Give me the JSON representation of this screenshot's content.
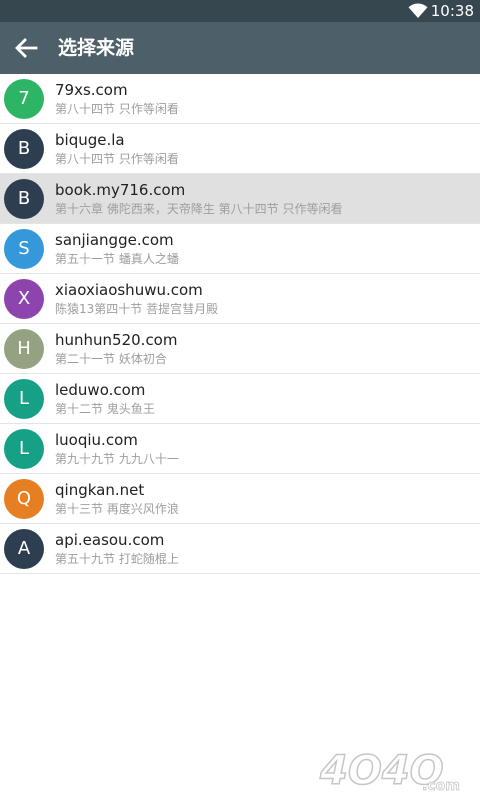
{
  "status_bar": {
    "time": "10:38",
    "icons": [
      "wifi-icon"
    ]
  },
  "toolbar": {
    "back_icon": "arrow-left-icon",
    "title": "选择来源"
  },
  "sources": [
    {
      "initial": "7",
      "name": "79xs.com",
      "chapter": "第八十四节 只作等闲看",
      "color": "#2db565",
      "selected": false
    },
    {
      "initial": "B",
      "name": "biquge.la",
      "chapter": "第八十四节 只作等闲看",
      "color": "#2c3e50",
      "selected": false
    },
    {
      "initial": "B",
      "name": "book.my716.com",
      "chapter": "第十六章 佛陀西来，天帝降生 第八十四节 只作等闲看",
      "color": "#2c3e50",
      "selected": true
    },
    {
      "initial": "S",
      "name": "sanjiangge.com",
      "chapter": "第五十一节 蟠真人之蟠",
      "color": "#3498db",
      "selected": false
    },
    {
      "initial": "X",
      "name": "xiaoxiaoshuwu.com",
      "chapter": "陈猿13第四十节 菩提宫彗月殿",
      "color": "#8e44ad",
      "selected": false
    },
    {
      "initial": "H",
      "name": "hunhun520.com",
      "chapter": "第二十一节 妖体初合",
      "color": "#95a281",
      "selected": false
    },
    {
      "initial": "L",
      "name": "leduwo.com",
      "chapter": "第十二节 鬼头鱼王",
      "color": "#16a085",
      "selected": false
    },
    {
      "initial": "L",
      "name": "luoqiu.com",
      "chapter": "第九十九节 九九八十一",
      "color": "#16a085",
      "selected": false
    },
    {
      "initial": "Q",
      "name": "qingkan.net",
      "chapter": "第十三节 再度兴风作浪",
      "color": "#e67e22",
      "selected": false
    },
    {
      "initial": "A",
      "name": "api.easou.com",
      "chapter": "第五十九节 打蛇随棍上",
      "color": "#2c3e50",
      "selected": false
    }
  ],
  "watermark": {
    "text": "4O4O",
    "suffix": ".com"
  }
}
